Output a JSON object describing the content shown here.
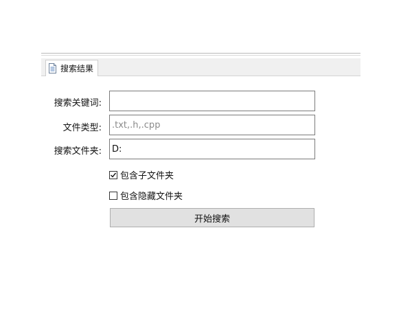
{
  "tab": {
    "label": "搜索结果",
    "icon": "document-icon"
  },
  "form": {
    "keyword": {
      "label": "搜索关键词:",
      "value": "",
      "placeholder": ""
    },
    "file_type": {
      "label": "文件类型:",
      "value": "",
      "placeholder": ".txt,.h,.cpp"
    },
    "folder": {
      "label": "搜索文件夹:",
      "value": "D:",
      "placeholder": ""
    },
    "include_subfolders": {
      "label": "包含子文件夹",
      "checked": true
    },
    "include_hidden": {
      "label": "包含隐藏文件夹",
      "checked": false
    },
    "start_button": {
      "label": "开始搜索"
    }
  },
  "colors": {
    "button_bg": "#e1e1e1",
    "input_border": "#7a7a7a",
    "tab_strip_bg": "#f0f0f0"
  }
}
